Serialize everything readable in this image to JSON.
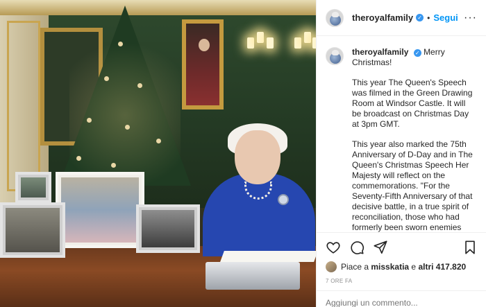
{
  "post": {
    "username": "theroyalfamily",
    "follow_label": "Segui",
    "separator": "•",
    "more_label": "···",
    "caption_greeting": "Merry Christmas!",
    "paragraphs": [
      "This year The Queen's Speech was filmed in the Green Drawing Room at Windsor Castle. It will be broadcast on Christmas Day at 3pm GMT.",
      "This year also marked the 75th Anniversary of D-Day and in The Queen's Christmas Speech Her Majesty will reflect on the commemorations. \"For the Seventy-Fifth Anniversary of that decisive battle, in a true spirit of reconciliation, those who had formerly been sworn enemies came together in friendly commemorations either side of the Channel, putting past differences behind them."
    ],
    "likes_prefix": "Piace a ",
    "likes_user": "misskatia",
    "likes_middle": " e ",
    "likes_count": "altri 417.820",
    "timestamp": "7 ORE FA",
    "comment_placeholder": "Aggiungi un commento..."
  },
  "icons": {
    "like": "heart-icon",
    "comment": "comment-icon",
    "share": "share-icon",
    "save": "bookmark-icon",
    "verified": "verified-badge-icon"
  },
  "colors": {
    "accent": "#0095f6",
    "verified": "#3897f0",
    "muted": "#8e8e8e",
    "text": "#262626"
  }
}
